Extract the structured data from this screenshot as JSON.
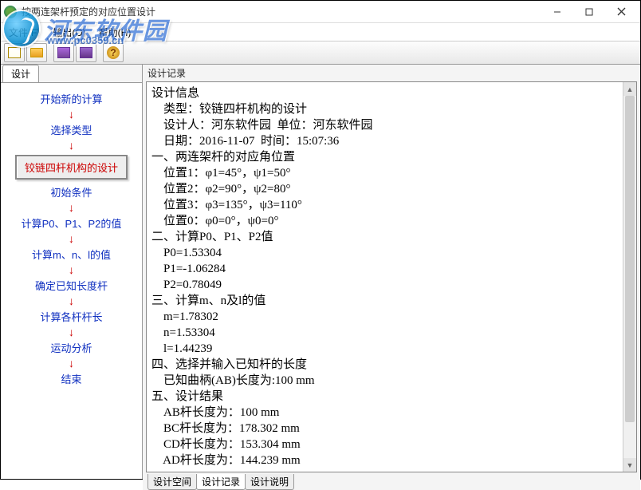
{
  "window": {
    "title": "按两连架杆预定的对应位置设计"
  },
  "menu": {
    "file": "文件(F)",
    "output": "输出(O)",
    "help": "帮助(H)"
  },
  "watermark": {
    "text": "河东软件园",
    "url": "www.pc0359.cn"
  },
  "left": {
    "tab": "设计",
    "steps": {
      "s1": "开始新的计算",
      "s2": "选择类型",
      "s3": "铰链四杆机构的设计",
      "s4": "初始条件",
      "s5": "计算P0、P1、P2的值",
      "s6": "计算m、n、l的值",
      "s7": "确定已知长度杆",
      "s8": "计算各杆杆长",
      "s9": "运动分析",
      "s10": "结束"
    }
  },
  "right": {
    "header": "设计记录",
    "tabs": {
      "t1": "设计空间",
      "t2": "设计记录",
      "t3": "设计说明"
    },
    "info": {
      "h": "设计信息",
      "type_lbl": "    类型：",
      "type_val": "铰链四杆机构的设计",
      "designer_lbl": "    设计人：",
      "designer_val": "河东软件园",
      "unit_lbl": "  单位：",
      "unit_val": "河东软件园",
      "date_lbl": "    日期：",
      "date_val": "2016-11-07",
      "time_lbl": "  时间：",
      "time_val": "15:07:36"
    },
    "sec1": {
      "h": "一、两连架杆的对应角位置",
      "p1": "    位置1：φ1=45°，ψ1=50°",
      "p2": "    位置2：φ2=90°，ψ2=80°",
      "p3": "    位置3：φ3=135°，ψ3=110°",
      "p0": "    位置0：φ0=0°，ψ0=0°"
    },
    "sec2": {
      "h": "二、计算P0、P1、P2值",
      "p0": "    P0=1.53304",
      "p1": "    P1=-1.06284",
      "p2": "    P2=0.78049"
    },
    "sec3": {
      "h": "三、计算m、n及l的值",
      "m": "    m=1.78302",
      "n": "    n=1.53304",
      "l": "    l=1.44239"
    },
    "sec4": {
      "h": "四、选择并输入已知杆的长度",
      "known": "    已知曲柄(AB)长度为:100 mm"
    },
    "sec5": {
      "h": "五、设计结果",
      "ab": "    AB杆长度为：100 mm",
      "bc": "    BC杆长度为：178.302 mm",
      "cd": "    CD杆长度为：153.304 mm",
      "ad": "    AD杆长度为：144.239 mm"
    }
  }
}
